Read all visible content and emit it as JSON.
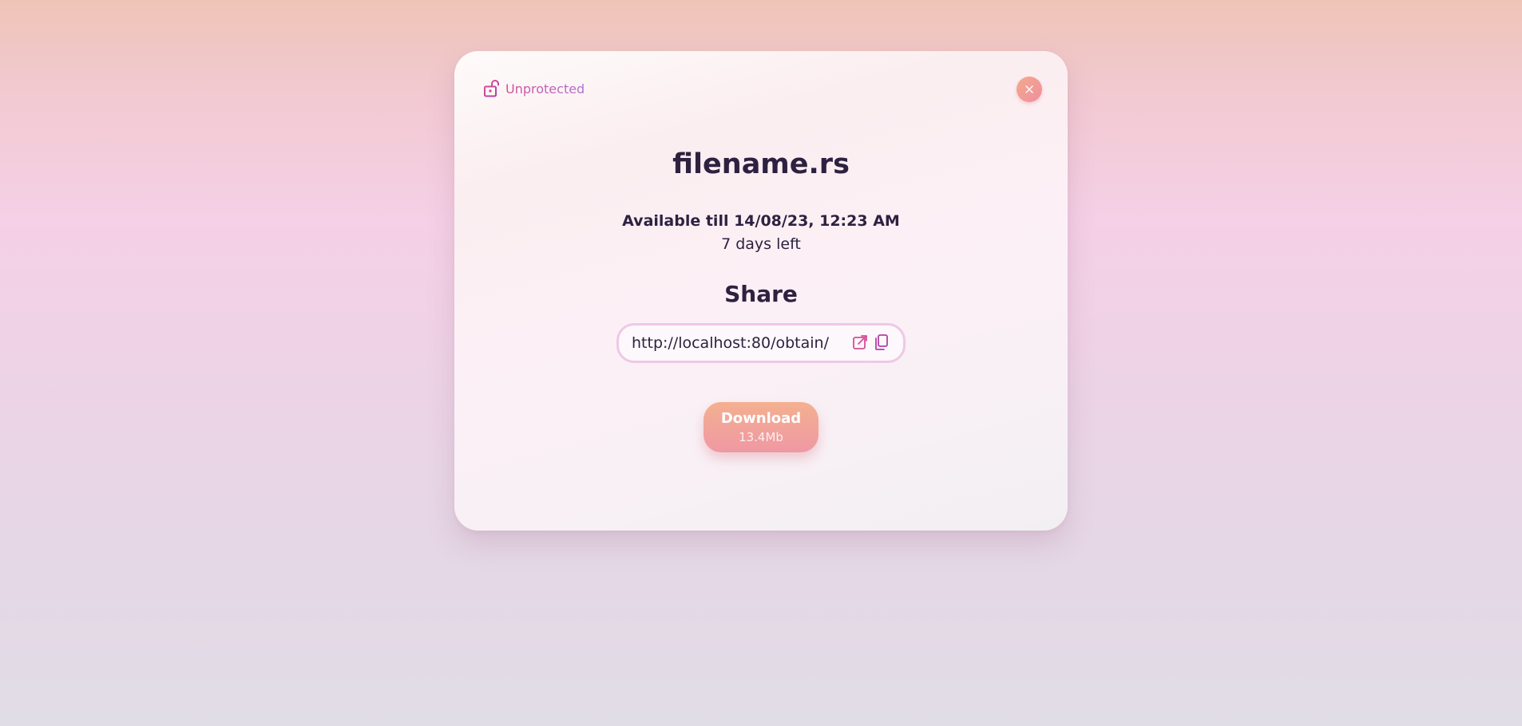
{
  "status": {
    "icon": "lock-open-icon",
    "label": "Unprotected"
  },
  "close": {
    "icon": "close-icon",
    "label": "×"
  },
  "file": {
    "name": "filename.rs",
    "availability": "Available till 14/08/23, 12:23 AM",
    "remaining": "7 days left"
  },
  "share": {
    "heading": "Share",
    "url": "http://localhost:80/obtain/",
    "open_icon": "external-link-icon",
    "copy_icon": "copy-icon"
  },
  "download": {
    "label": "Download",
    "size": "13.4Mb"
  },
  "colors": {
    "accent_pink": "#d44f97",
    "accent_violet": "#b270d6",
    "button_peach": "#f4b090",
    "button_rose": "#ef98a4",
    "text_dark": "#2e2140"
  }
}
